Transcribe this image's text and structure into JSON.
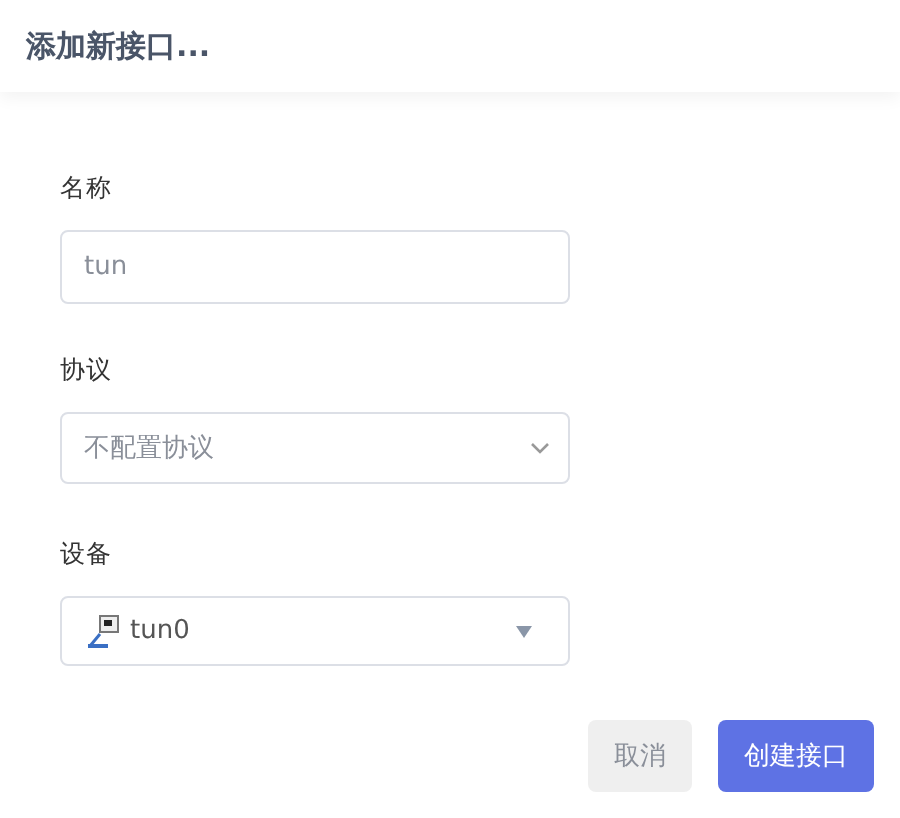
{
  "dialog": {
    "title": "添加新接口..."
  },
  "fields": [
    {
      "kind": "text",
      "label": "名称",
      "placeholder": "tun"
    },
    {
      "kind": "select",
      "label": "协议",
      "value": "不配置协议"
    },
    {
      "kind": "device",
      "label": "设备",
      "value": "tun0"
    }
  ],
  "buttons": [
    {
      "label": "取消",
      "kind": "secondary"
    },
    {
      "label": "创建接口",
      "kind": "primary"
    }
  ]
}
